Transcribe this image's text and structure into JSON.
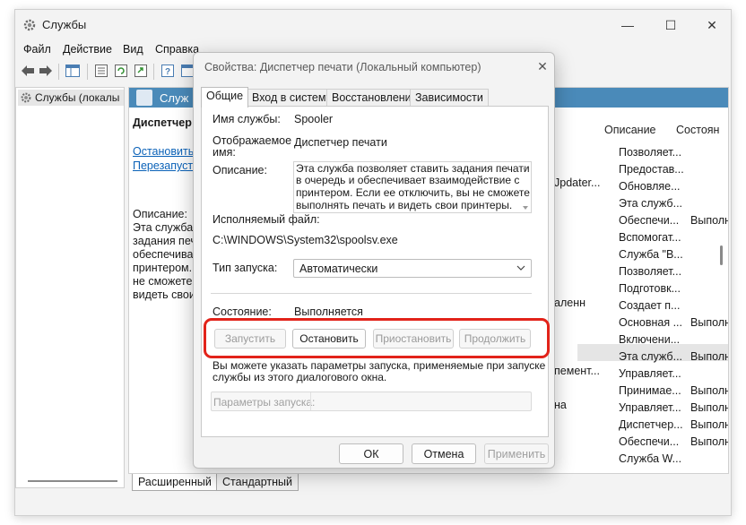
{
  "window": {
    "title": "Службы",
    "minimize_glyph": "—",
    "maximize_glyph": "☐",
    "close_glyph": "✕"
  },
  "menu": [
    "Файл",
    "Действие",
    "Вид",
    "Справка"
  ],
  "tree": {
    "item": "Службы (локалы"
  },
  "main": {
    "header": "Служ",
    "service_name": "Диспетчер п",
    "link_stop": "Остановить",
    "link_restart": "Перезапусти",
    "desc_label": "Описание:",
    "desc_lines": [
      "Эта служба п",
      "задания печа",
      "обеспечивае",
      "принтером.",
      "не сможете",
      "видеть свои"
    ],
    "columns": {
      "description": "Описание",
      "status": "Состоян"
    },
    "name_fragments": [
      "Jpdater...",
      "аленн",
      "пемент...",
      "на"
    ],
    "rows": [
      {
        "desc": "Позволяет...",
        "status": ""
      },
      {
        "desc": "Предостав...",
        "status": ""
      },
      {
        "desc": "Обновляе...",
        "status": ""
      },
      {
        "desc": "Эта служб...",
        "status": ""
      },
      {
        "desc": "Обеспечи...",
        "status": "Выполня"
      },
      {
        "desc": "Вспомогат...",
        "status": ""
      },
      {
        "desc": "Служба \"В...",
        "status": ""
      },
      {
        "desc": "Позволяет...",
        "status": ""
      },
      {
        "desc": "Подготовк...",
        "status": ""
      },
      {
        "desc": "Создает п...",
        "status": ""
      },
      {
        "desc": "Основная ...",
        "status": "Выполня"
      },
      {
        "desc": "Включени...",
        "status": ""
      },
      {
        "desc": "Эта служб...",
        "status": "Выполня"
      },
      {
        "desc": "Управляет...",
        "status": ""
      },
      {
        "desc": "Принимае...",
        "status": "Выполня"
      },
      {
        "desc": "Управляет...",
        "status": "Выполня"
      },
      {
        "desc": "Диспетчер...",
        "status": "Выполня"
      },
      {
        "desc": "Обеспечи...",
        "status": "Выполня"
      },
      {
        "desc": "Служба W...",
        "status": ""
      }
    ],
    "tabs": [
      "Расширенный",
      "Стандартный"
    ]
  },
  "dialog": {
    "title": "Свойства: Диспетчер печати (Локальный компьютер)",
    "tabs": [
      "Общие",
      "Вход в систему",
      "Восстановление",
      "Зависимости"
    ],
    "service_name_label": "Имя службы:",
    "service_name": "Spooler",
    "display_name_label_1": "Отображаемое",
    "display_name_label_2": "имя:",
    "display_name": "Диспетчер печати",
    "description_label": "Описание:",
    "description_lines": [
      "Эта служба позволяет ставить задания печати",
      "в очередь и обеспечивает взаимодействие с",
      "принтером.  Если ее отключить, вы не сможете",
      "выполнять печать и видеть свои принтеры."
    ],
    "exe_label": "Исполняемый файл:",
    "exe_path": "C:\\WINDOWS\\System32\\spoolsv.exe",
    "startup_label": "Тип запуска:",
    "startup_value": "Автоматически",
    "status_label": "Состояние:",
    "status_value": "Выполняется",
    "btn_start": "Запустить",
    "btn_stop": "Остановить",
    "btn_pause": "Приостановить",
    "btn_resume": "Продолжить",
    "hint_line_1": "Вы можете указать параметры запуска, применяемые при запуске",
    "hint_line_2": "службы из этого диалогового окна.",
    "params_label": "Параметры запуска:",
    "btn_ok": "ОК",
    "btn_cancel": "Отмена",
    "btn_apply": "Применить",
    "highlight_color": "#e2231a"
  }
}
